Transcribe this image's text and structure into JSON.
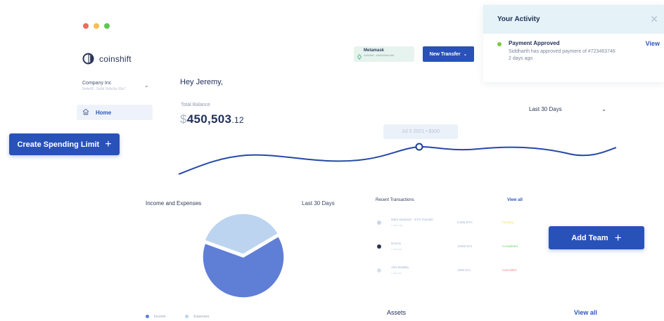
{
  "window": {
    "traffic_lights": [
      "#ee6b5f",
      "#f4bf4f",
      "#61c554"
    ]
  },
  "brand": {
    "name": "coinshift",
    "icon": "coinshift-logo-icon"
  },
  "company": {
    "name": "Company Inc",
    "sub": "0x4e6F...5a9d 0x6e3a 03e7"
  },
  "sidebar": {
    "items": [
      {
        "label": "Home",
        "icon": "home-icon"
      }
    ]
  },
  "buttons": {
    "create_spending_limit": "Create Spending Limit",
    "new_transfer": "New Transfer",
    "add_team": "Add Team"
  },
  "header": {
    "greeting": "Hey Jeremy,",
    "wallet": {
      "name": "Metamask",
      "address": "0x6a5af...e6a5f2bae3b8"
    }
  },
  "balance": {
    "label": "Total Balance",
    "currency": "$",
    "whole": "450,503",
    "cents": ".12"
  },
  "range_filter": "Last 30 Days",
  "balance_chart": {
    "tooltip": "Jul 5 2021 • $300"
  },
  "activity": {
    "title": "Your Activity",
    "item": {
      "title": "Payment Approved",
      "desc": "Siddharth has approved payment of #723463746",
      "time": "2 days ago",
      "action": "View"
    }
  },
  "income_expenses": {
    "title": "Income and Expenses",
    "range": "Last 30 Days",
    "legend": [
      "Income",
      "Expenses"
    ],
    "colors": {
      "income": "#5f7ed6",
      "expenses": "#bcd4ef"
    }
  },
  "chart_data": {
    "type": "pie",
    "labels": [
      "Income",
      "Expenses"
    ],
    "values": [
      64,
      36
    ]
  },
  "transactions": {
    "title": "Recent Transactions",
    "view_all": "View all",
    "rows": [
      {
        "name": "Mark Abraham - ETH Transfer",
        "sub": "2 days ago",
        "amount": "0.005 ETH",
        "status": "Pending",
        "status_color": "#f4e27a",
        "icon_color": "#c9d6ec"
      },
      {
        "name": "Dennis",
        "sub": "1 day ago",
        "amount": "12000 DAI",
        "status": "Completed",
        "status_color": "#6fd36e",
        "icon_color": "#2d3450"
      },
      {
        "name": "Alex Bradley",
        "sub": "1 day ago",
        "amount": "1500 DAI",
        "status": "Cancelled",
        "status_color": "#f08585",
        "icon_color": "#d7dfee"
      }
    ]
  },
  "assets": {
    "title": "Assets",
    "view_all": "View all"
  }
}
